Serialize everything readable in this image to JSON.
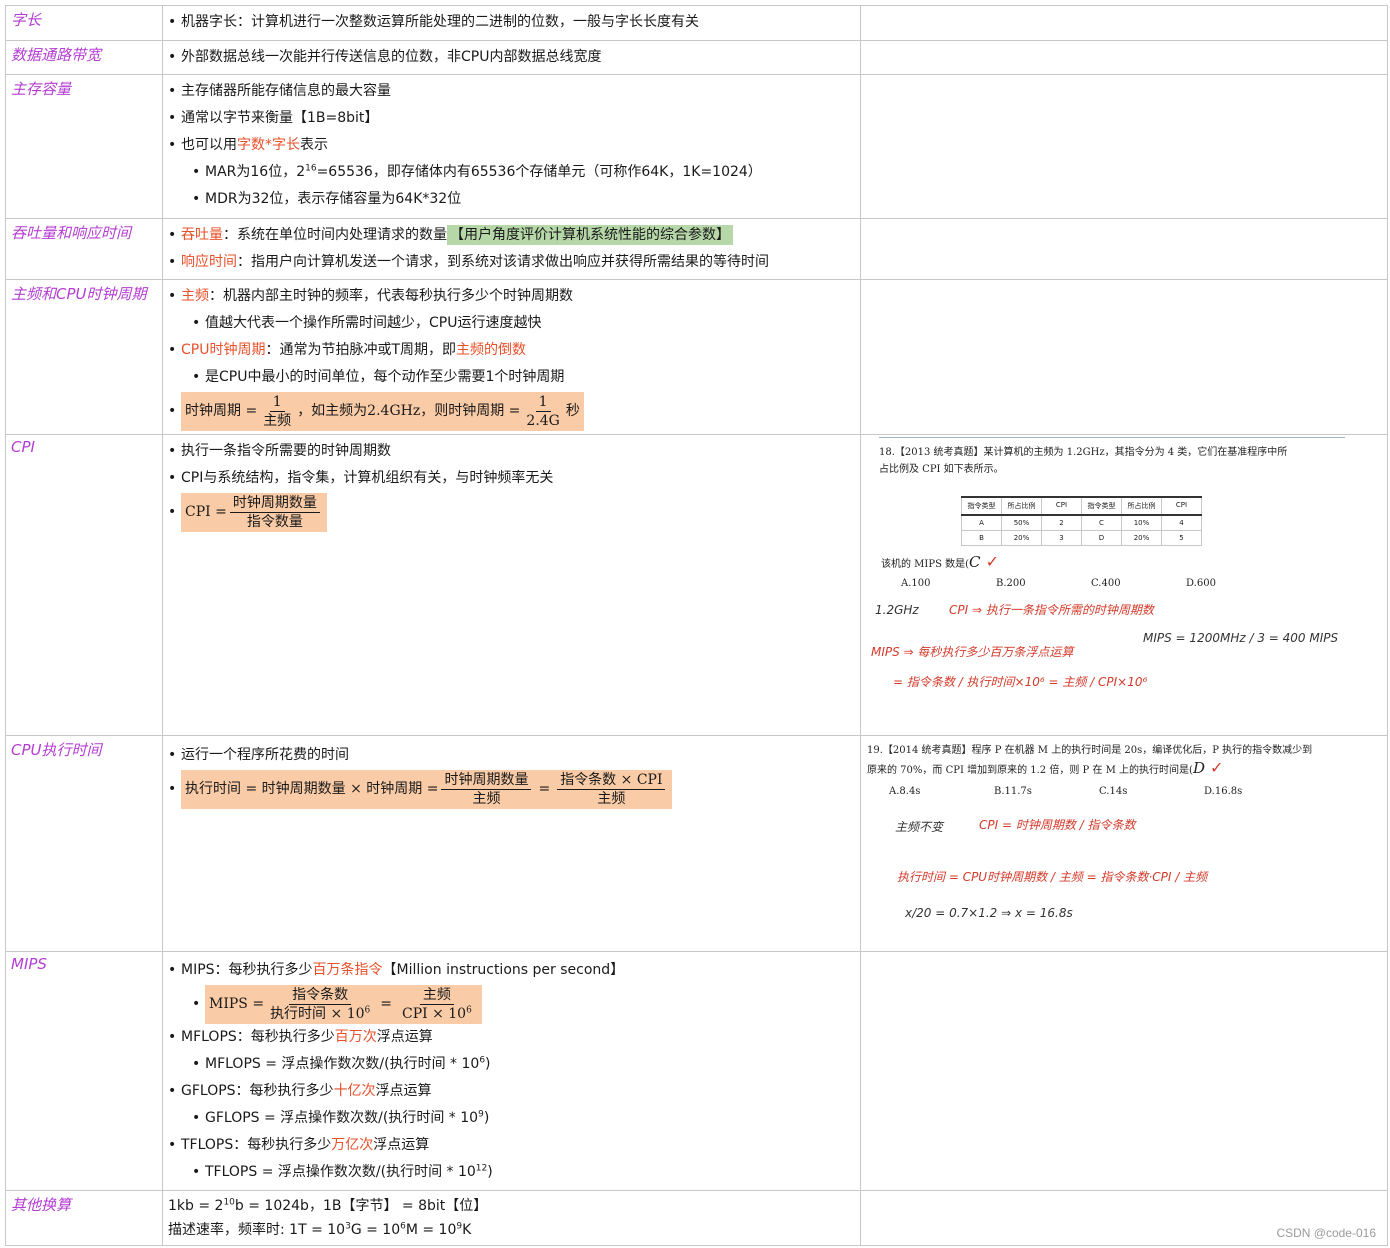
{
  "rows": [
    {
      "term": "字长",
      "bullets": [
        {
          "text": "机器字长：计算机进行一次整数运算所能处理的二进制的位数，一般与字长长度有关"
        }
      ]
    },
    {
      "term": "数据通路带宽",
      "bullets": [
        {
          "text": "外部数据总线一次能并行传送信息的位数，非CPU内部数据总线宽度"
        }
      ]
    },
    {
      "term": "主存容量",
      "bullets": [
        "主存储器所能存储信息的最大容量",
        "通常以字节来衡量【1B=8bit】",
        {
          "pre": "也可以用",
          "red": "字数*字长",
          "post": "表示"
        },
        {
          "pre": "MAR为16位，2",
          "sup": "16",
          "post": "=65536，即存储体内有65536个存储单元（可称作64K，1K=1024）"
        },
        "MDR为32位，表示存储容量为64K*32位"
      ]
    },
    {
      "term": "吞吐量和响应时间",
      "throughput": {
        "red": "吞吐量",
        "text": "：系统在单位时间内处理请求的数量",
        "highlight": "【用户角度评价计算机系统性能的综合参数】"
      },
      "response": {
        "red": "响应时间",
        "text": "：指用户向计算机发送一个请求，到系统对该请求做出响应并获得所需结果的等待时间"
      }
    },
    {
      "term": "主频和CPU时钟周期",
      "freq": {
        "red": "主频",
        "text": "：机器内部主时钟的频率，代表每秒执行多少个时钟周期数"
      },
      "freq_sub": "值越大代表一个操作所需时间越少，CPU运行速度越快",
      "clock": {
        "red": "CPU时钟周期",
        "text": "：通常为节拍脉冲或T周期，即",
        "red2": "主频的倒数"
      },
      "clock_sub": "是CPU中最小的时间单位，每个动作至少需要1个时钟周期",
      "formula": {
        "lhs": "时钟周期 =",
        "num1": "1",
        "den1": "主频",
        "mid": "，如主频为2.4GHz，则时钟周期 =",
        "num2": "1",
        "den2": "2.4G",
        "tail": "秒"
      }
    },
    {
      "term": "CPI",
      "bullets": [
        "执行一条指令所需要的时钟周期数",
        "CPI与系统结构，指令集，计算机组织有关，与时钟频率无关"
      ],
      "formula": {
        "lhs": "CPI =",
        "num": "时钟周期数量",
        "den": "指令数量"
      },
      "exam": {
        "q1": "18.【2013 统考真题】某计算机的主频为 1.2GHz，其指令分为 4 类，它们在基准程序中所",
        "q2": "占比例及 CPI 如下表所示。",
        "table_head": [
          "指令类型",
          "所占比例",
          "CPI",
          "指令类型",
          "所占比例",
          "CPI"
        ],
        "table_rows": [
          [
            "A",
            "50%",
            "2",
            "C",
            "10%",
            "4"
          ],
          [
            "B",
            "20%",
            "3",
            "D",
            "20%",
            "5"
          ]
        ],
        "q3": "该机的 MIPS 数是(",
        "answer": "C",
        "options": [
          "A.100",
          "B.200",
          "C.400",
          "D.600"
        ],
        "note1": "1.2GHz",
        "note2": "CPI ⇒ 执行一条指令所需的时钟周期数",
        "note3": "MIPS ⇒ 每秒执行多少百万条浮点运算",
        "note4": "= 指令条数 / 执行时间×10⁶ = 主频 / CPI×10⁶",
        "note5": "MIPS = 1200MHz / 3 = 400 MIPS"
      }
    },
    {
      "term": "CPU执行时间",
      "bullets": [
        "运行一个程序所花费的时间"
      ],
      "formula": {
        "lhs": "执行时间 = 时钟周期数量 × 时钟周期 =",
        "num1": "时钟周期数量",
        "den1": "主频",
        "eq": "=",
        "num2": "指令条数 × CPI",
        "den2": "主频"
      },
      "exam": {
        "q1": "19.【2014 统考真题】程序 P 在机器 M 上的执行时间是 20s，编译优化后，P 执行的指令数减少到",
        "q2": "原来的 70%，而 CPI 增加到原来的 1.2 倍，则 P 在 M 上的执行时间是(",
        "answer": "D",
        "options": [
          "A.8.4s",
          "B.11.7s",
          "C.14s",
          "D.16.8s"
        ],
        "note1": "主频不变",
        "note2": "CPI = 时钟周期数 / 指令条数",
        "note3": "执行时间 = CPU时钟周期数 / 主频 = 指令条数·CPI / 主频",
        "note4": "x/20 = 0.7×1.2 ⇒ x = 16.8s"
      }
    },
    {
      "term": "MIPS",
      "mips": {
        "pre": "MIPS：每秒执行多少",
        "red": "百万条指令",
        "post": "【Million instructions per second】"
      },
      "mips_formula": {
        "lhs": "MIPS =",
        "num1": "指令条数",
        "den1": "执行时间 × 10",
        "den1_sup": "6",
        "eq": "=",
        "num2": "主频",
        "den2": "CPI × 10",
        "den2_sup": "6"
      },
      "mflops": {
        "pre": "MFLOPS：每秒执行多少",
        "red": "百万次",
        "post": "浮点运算"
      },
      "mflops_sub": {
        "text": "MFLOPS = 浮点操作数次数/(执行时间 * 10",
        "sup": "6",
        "tail": ")"
      },
      "gflops": {
        "pre": "GFLOPS：每秒执行多少",
        "red": "十亿次",
        "post": "浮点运算"
      },
      "gflops_sub": {
        "text": "GFLOPS = 浮点操作数次数/(执行时间 * 10",
        "sup": "9",
        "tail": ")"
      },
      "tflops": {
        "pre": "TFLOPS：每秒执行多少",
        "red": "万亿次",
        "post": "浮点运算"
      },
      "tflops_sub": {
        "text": "TFLOPS = 浮点操作数次数/(执行时间 * 10",
        "sup": "12",
        "tail": ")"
      }
    },
    {
      "term": "其他换算",
      "line1": {
        "a": "1kb = 2",
        "sup": "10",
        "b": "b = 1024b，1B【字节】 = 8bit【位】"
      },
      "line2": {
        "a": "描述速率，频率时: 1T = 10",
        "s1": "3",
        "b": "G = 10",
        "s2": "6",
        "c": "M = 10",
        "s3": "9",
        "d": "K"
      }
    }
  ],
  "watermark": "CSDN @code-016"
}
